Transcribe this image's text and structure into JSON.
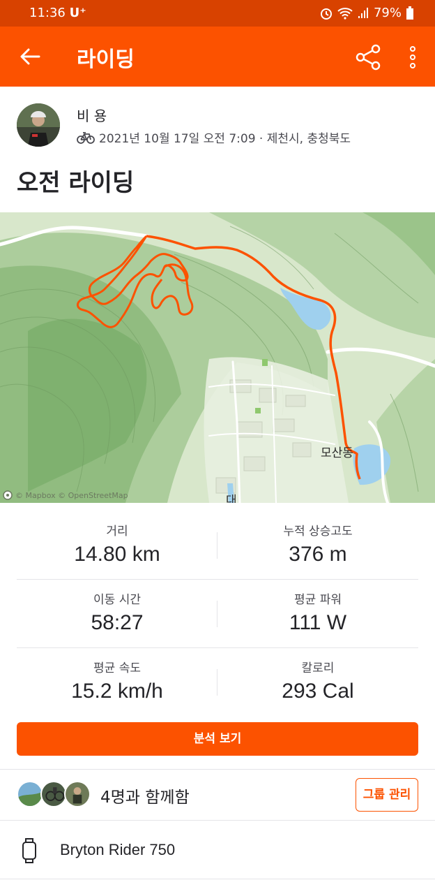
{
  "status_bar": {
    "time": "11:36",
    "carrier": "U⁺",
    "battery": "79%"
  },
  "app_bar": {
    "title": "라이딩"
  },
  "athlete": {
    "name": "비 용",
    "meta": "2021년 10월 17일 오전 7:09 · 제천시, 충청북도"
  },
  "activity": {
    "title": "오전 라이딩"
  },
  "map": {
    "attribution": "© Mapbox © OpenStreetMap",
    "place_label": "모산동",
    "place_label_2": "대"
  },
  "stats": [
    {
      "left_label": "거리",
      "left_value": "14.80 km",
      "right_label": "누적 상승고도",
      "right_value": "376 m"
    },
    {
      "left_label": "이동 시간",
      "left_value": "58:27",
      "right_label": "평균 파워",
      "right_value": "111 W"
    },
    {
      "left_label": "평균 속도",
      "left_value": "15.2 km/h",
      "right_label": "칼로리",
      "right_value": "293 Cal"
    }
  ],
  "analyze_button": "분석 보기",
  "group": {
    "text": "4명과 함께함",
    "button": "그룹 관리"
  },
  "device": {
    "name": "Bryton Rider 750"
  },
  "colors": {
    "brand": "#fc5200",
    "status_bar": "#d84200",
    "route": "#fc5200",
    "water": "#9fd0ee"
  }
}
